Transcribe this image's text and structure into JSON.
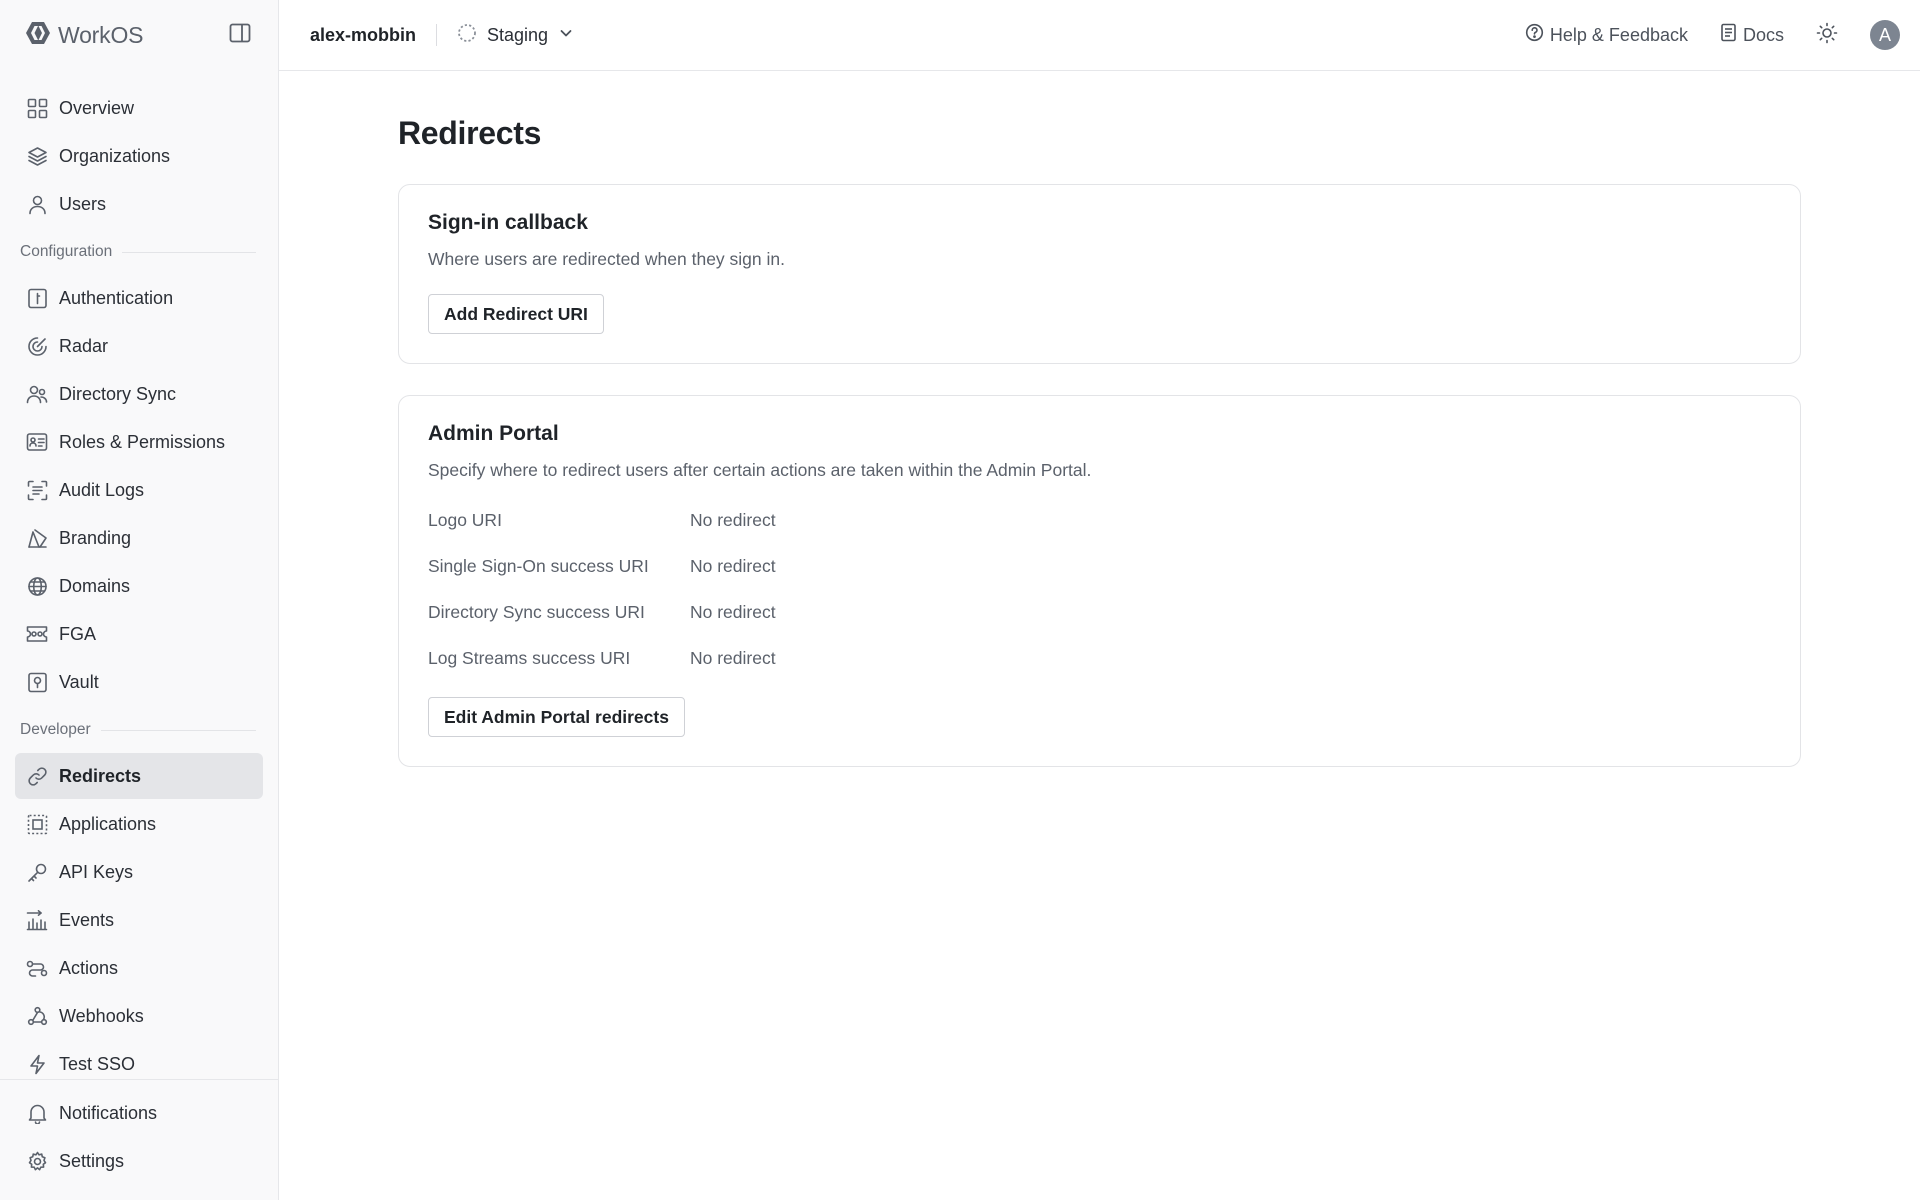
{
  "brand": {
    "name": "WorkOS"
  },
  "sidebar": {
    "top_items": [
      {
        "label": "Overview",
        "icon": "grid-icon"
      },
      {
        "label": "Organizations",
        "icon": "layers-icon"
      },
      {
        "label": "Users",
        "icon": "user-icon"
      }
    ],
    "configuration_label": "Configuration",
    "configuration_items": [
      {
        "label": "Authentication",
        "icon": "key-box-icon"
      },
      {
        "label": "Radar",
        "icon": "radar-icon"
      },
      {
        "label": "Directory Sync",
        "icon": "users-sync-icon"
      },
      {
        "label": "Roles & Permissions",
        "icon": "id-card-icon"
      },
      {
        "label": "Audit Logs",
        "icon": "scan-list-icon"
      },
      {
        "label": "Branding",
        "icon": "brush-icon"
      },
      {
        "label": "Domains",
        "icon": "globe-icon"
      },
      {
        "label": "FGA",
        "icon": "ticket-icon"
      },
      {
        "label": "Vault",
        "icon": "vault-icon"
      }
    ],
    "developer_label": "Developer",
    "developer_items": [
      {
        "label": "Redirects",
        "icon": "link-icon"
      },
      {
        "label": "Applications",
        "icon": "app-frame-icon"
      },
      {
        "label": "API Keys",
        "icon": "key-icon"
      },
      {
        "label": "Events",
        "icon": "events-icon"
      },
      {
        "label": "Actions",
        "icon": "actions-icon"
      },
      {
        "label": "Webhooks",
        "icon": "webhook-icon"
      },
      {
        "label": "Test SSO",
        "icon": "bolt-icon"
      }
    ],
    "bottom_items": [
      {
        "label": "Notifications",
        "icon": "bell-icon"
      },
      {
        "label": "Settings",
        "icon": "gear-icon"
      }
    ],
    "active": "Redirects"
  },
  "topbar": {
    "team": "alex-mobbin",
    "environment": "Staging",
    "help_label": "Help & Feedback",
    "docs_label": "Docs",
    "avatar_initial": "A"
  },
  "page": {
    "title": "Redirects",
    "signin_card": {
      "title": "Sign-in callback",
      "description": "Where users are redirected when they sign in.",
      "button": "Add Redirect URI"
    },
    "admin_card": {
      "title": "Admin Portal",
      "description": "Specify where to redirect users after certain actions are taken within the Admin Portal.",
      "rows": [
        {
          "label": "Logo URI",
          "value": "No redirect"
        },
        {
          "label": "Single Sign-On success URI",
          "value": "No redirect"
        },
        {
          "label": "Directory Sync success URI",
          "value": "No redirect"
        },
        {
          "label": "Log Streams success URI",
          "value": "No redirect"
        }
      ],
      "button": "Edit Admin Portal redirects"
    }
  }
}
